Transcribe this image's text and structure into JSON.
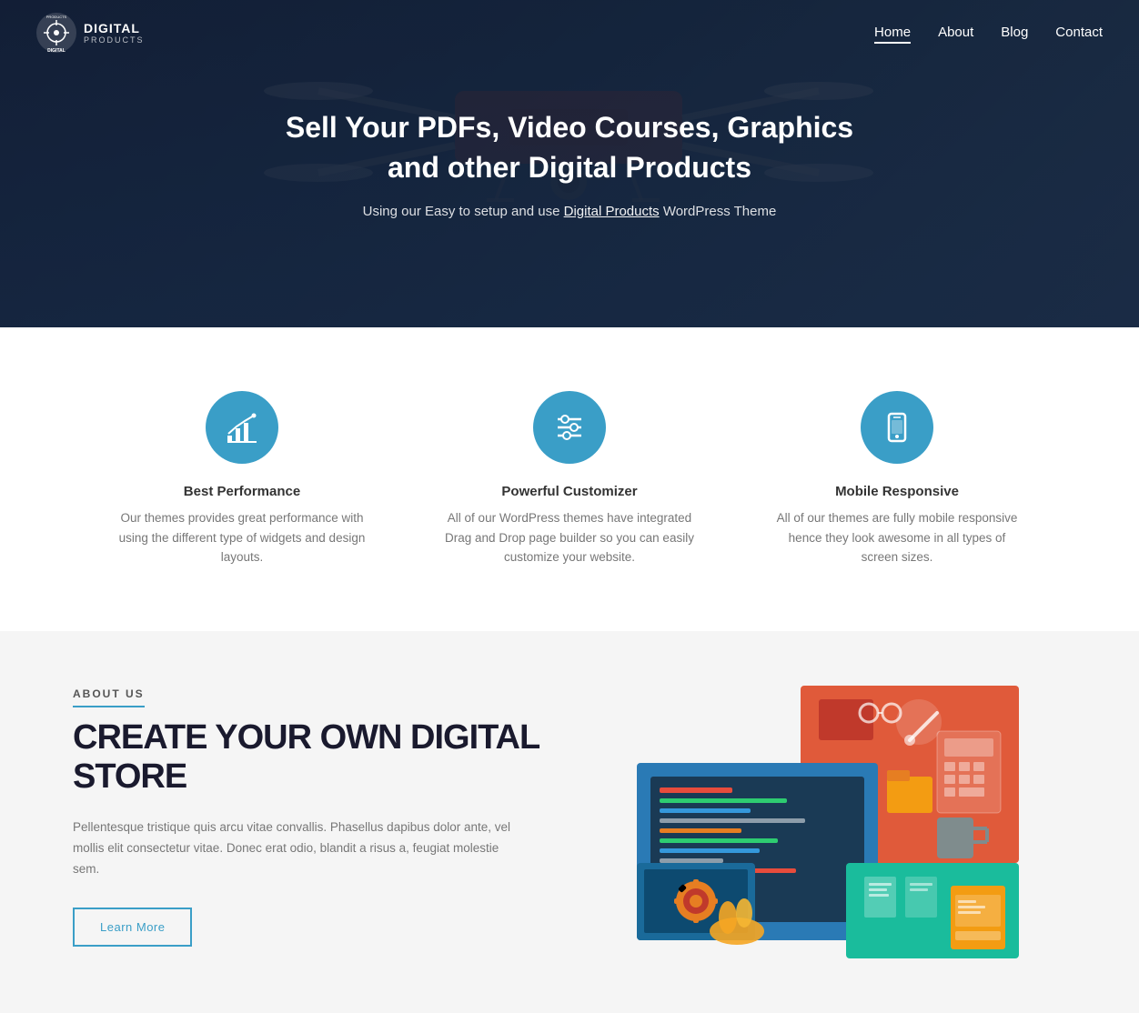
{
  "nav": {
    "logo_alt": "Digital Products",
    "links": [
      {
        "label": "Home",
        "active": true,
        "href": "#"
      },
      {
        "label": "About",
        "active": false,
        "href": "#"
      },
      {
        "label": "Blog",
        "active": false,
        "href": "#"
      },
      {
        "label": "Contact",
        "active": false,
        "href": "#"
      }
    ]
  },
  "hero": {
    "title": "Sell Your PDFs, Video Courses, Graphics\nand other Digital Products",
    "subtitle_before": "Using our Easy to setup and use ",
    "subtitle_link": "Digital Products",
    "subtitle_after": " WordPress Theme"
  },
  "features": [
    {
      "id": "best-performance",
      "icon": "chart",
      "title": "Best Performance",
      "description": "Our themes provides great performance with using the different type of widgets and design layouts."
    },
    {
      "id": "powerful-customizer",
      "icon": "sliders",
      "title": "Powerful Customizer",
      "description": "All of our WordPress themes have integrated Drag and Drop page builder so you can easily customize your website."
    },
    {
      "id": "mobile-responsive",
      "icon": "mobile",
      "title": "Mobile Responsive",
      "description": "All of our themes are fully mobile responsive hence they look awesome in all types of screen sizes."
    }
  ],
  "about": {
    "label": "ABOUT US",
    "heading_line1": "CREATE YOUR OWN DIGITAL",
    "heading_line2": "STORE",
    "body": "Pellentesque tristique quis arcu vitae convallis. Phasellus dapibus dolor ante, vel mollis elit consectetur vitae. Donec erat odio, blandit a risus a, feugiat molestie sem.",
    "cta_label": "Learn More"
  }
}
